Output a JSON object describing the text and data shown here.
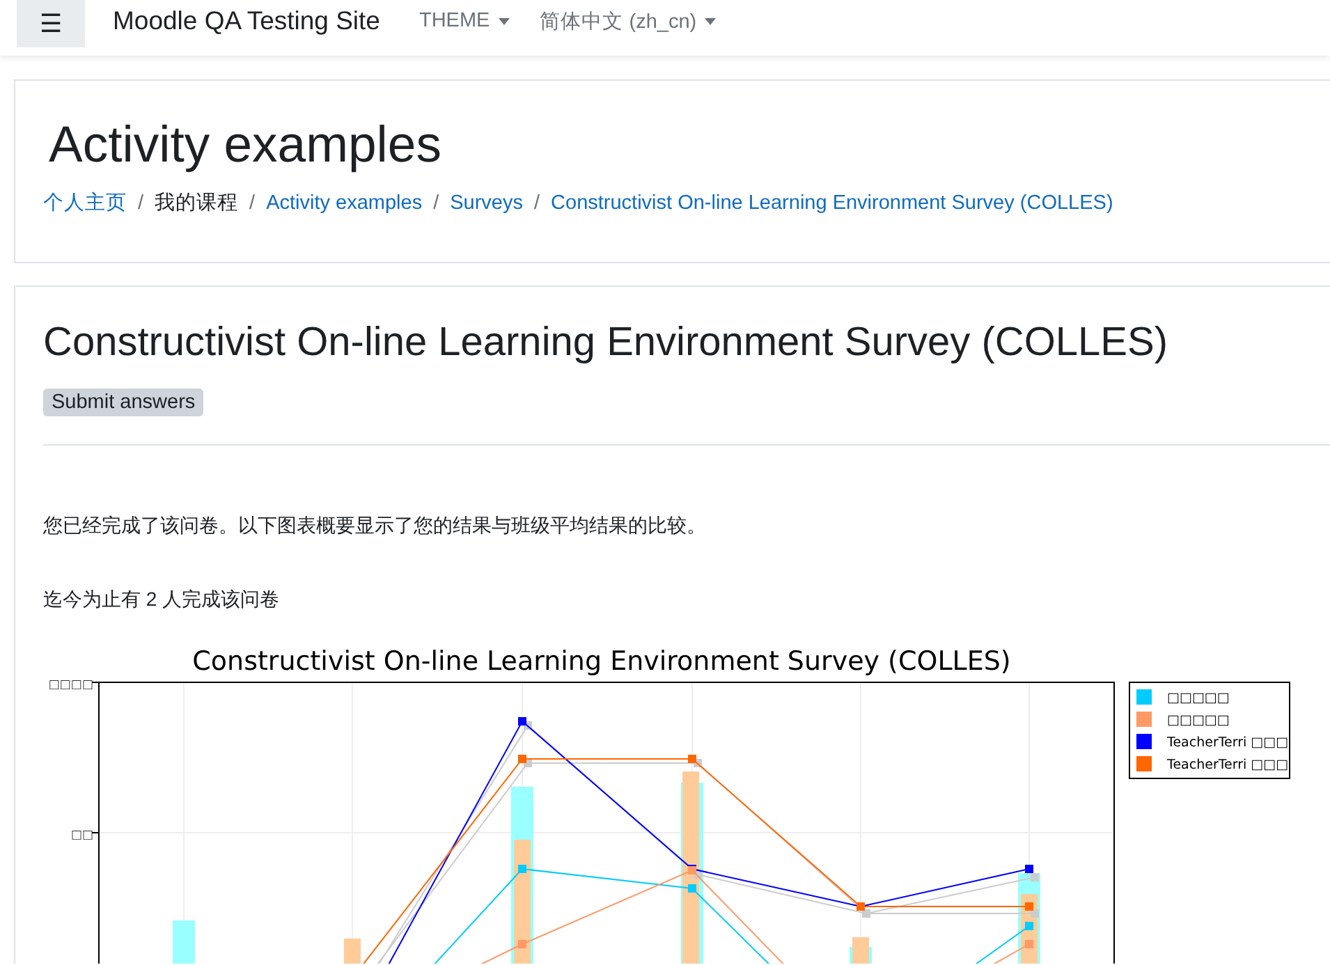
{
  "navbar": {
    "menu_icon": "☰",
    "site_name": "Moodle QA Testing Site",
    "menus": [
      {
        "label": "THEME"
      },
      {
        "label": "简体中文 (zh_cn)"
      }
    ]
  },
  "header": {
    "title": "Activity examples",
    "separator": "/",
    "breadcrumb": [
      {
        "label": "个人主页",
        "kind": "link"
      },
      {
        "label": "我的课程",
        "kind": "text"
      },
      {
        "label": "Activity examples",
        "kind": "link"
      },
      {
        "label": "Surveys",
        "kind": "link"
      },
      {
        "label": "Constructivist On-line Learning Environment Survey (COLLES)",
        "kind": "link"
      }
    ]
  },
  "main": {
    "title": "Constructivist On-line Learning Environment Survey (COLLES)",
    "button": "Submit answers",
    "paragraphs": [
      "您已经完成了该问卷。以下图表概要显示了您的结果与班级平均结果的比较。",
      "迄今为止有 2 人完成该问卷"
    ],
    "chart": {
      "title": "Constructivist On-line Learning Environment Survey (COLLES)",
      "y_labels": [
        "□□□□",
        "□□"
      ],
      "legend": [
        {
          "label": "□□□□□",
          "color": "#00ccff"
        },
        {
          "label": "□□□□□",
          "color": "#ff9966"
        },
        {
          "label": "TeacherTerri □□□",
          "color": "#0000ff"
        },
        {
          "label": "TeacherTerri □□□",
          "color": "#ff6600"
        }
      ]
    }
  }
}
